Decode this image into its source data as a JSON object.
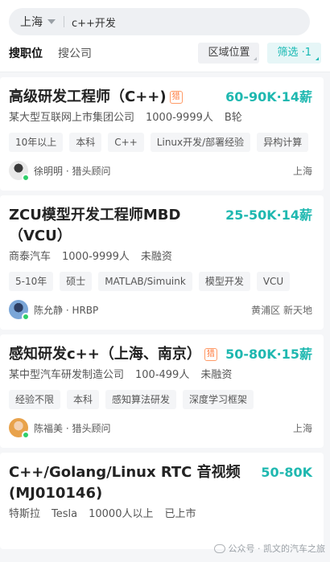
{
  "search": {
    "city": "上海",
    "keyword": "c++开发"
  },
  "tabs": [
    {
      "label": "搜职位",
      "active": true
    },
    {
      "label": "搜公司",
      "active": false
    }
  ],
  "filters": {
    "region": "区域位置",
    "screen": "筛选 ·1"
  },
  "jobs": [
    {
      "title": "高级研发工程师（C++)",
      "badge": "猎",
      "salary": "60-90K·14薪",
      "company": "某大型互联网上市集团公司",
      "size": "1000-9999人",
      "stage": "B轮",
      "tags": [
        "10年以上",
        "本科",
        "C++",
        "Linux开发/部署经验",
        "异构计算"
      ],
      "recruiter": "徐明明 · 猎头顾问",
      "location": "上海"
    },
    {
      "title": "ZCU模型开发工程师MBD（VCU）",
      "badge": "",
      "salary": "25-50K·14薪",
      "company": "商泰汽车",
      "size": "1000-9999人",
      "stage": "未融资",
      "tags": [
        "5-10年",
        "硕士",
        "MATLAB/Simuink",
        "模型开发",
        "VCU"
      ],
      "recruiter": "陈允静 · HRBP",
      "location": "黄浦区 新天地"
    },
    {
      "title": "感知研发c++（上海、南京）",
      "badge": "猎",
      "salary": "50-80K·15薪",
      "company": "某中型汽车研发制造公司",
      "size": "100-499人",
      "stage": "未融资",
      "tags": [
        "经验不限",
        "本科",
        "感知算法研发",
        "深度学习框架"
      ],
      "recruiter": "陈福美 · 猎头顾问",
      "location": "上海"
    },
    {
      "title": "C++/Golang/Linux RTC 音视频(MJ010146)",
      "badge": "",
      "salary": "50-80K",
      "company": "特斯拉",
      "alias": "Tesla",
      "size": "10000人以上",
      "stage": "已上市"
    }
  ],
  "watermark": "公众号 · 凯文的汽车之旅",
  "colors": {
    "accent": "#1fb8b0",
    "hunter_badge": "#ff7a3d",
    "online_dot": "#2fcf6a"
  }
}
